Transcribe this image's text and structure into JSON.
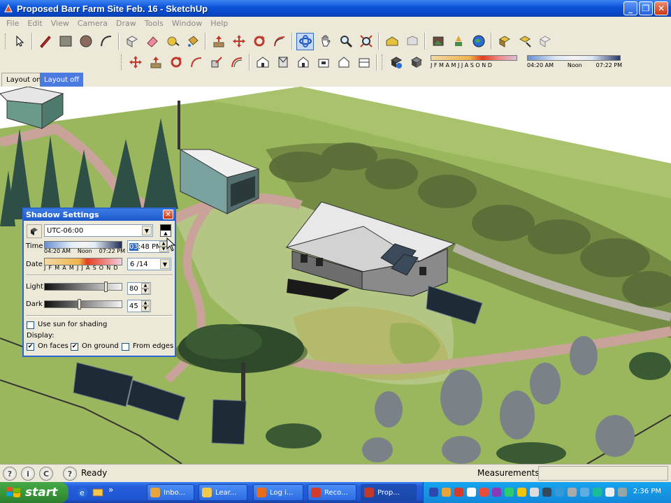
{
  "window": {
    "title": "Proposed Barr Farm Site Feb. 16 - SketchUp",
    "controls": {
      "minimize": "_",
      "maximize": "❐",
      "close": "✕"
    }
  },
  "menu": [
    "File",
    "Edit",
    "View",
    "Camera",
    "Draw",
    "Tools",
    "Window",
    "Help"
  ],
  "toolbar": {
    "shadow_months": "J F M A M J J A S O N D",
    "shadow_time_start": "04:20 AM",
    "shadow_time_mid": "Noon",
    "shadow_time_end": "07:22 PM"
  },
  "layout_tabs": {
    "on": "Layout on",
    "off": "Layout off"
  },
  "shadow_settings": {
    "title": "Shadow Settings",
    "timezone": "UTC-06:00",
    "time_label": "Time",
    "time_start": "04:20 AM",
    "time_mid": "Noon",
    "time_end": "07:22 PM",
    "time_value_selected": "03",
    "time_value_rest": ":48 PM",
    "date_label": "Date",
    "date_months": "J F M A M J J A S O N D",
    "date_value": "6 /14",
    "light_label": "Light",
    "light_value": "80",
    "light_level": 80,
    "dark_label": "Dark",
    "dark_value": "45",
    "dark_level": 45,
    "use_sun_label": "Use sun for shading",
    "use_sun_checked": false,
    "display_label": "Display:",
    "on_faces_label": "On faces",
    "on_faces_checked": true,
    "on_ground_label": "On ground",
    "on_ground_checked": true,
    "from_edges_label": "From edges",
    "from_edges_checked": false
  },
  "status": {
    "ready": "Ready",
    "measurements_label": "Measurements",
    "measurements_value": ""
  },
  "taskbar": {
    "start": "start",
    "tasks": [
      {
        "label": "Inbo...",
        "color": "#e8a33a"
      },
      {
        "label": "Lear...",
        "color": "#f3c84b"
      },
      {
        "label": "Log i...",
        "color": "#e76d1e"
      },
      {
        "label": "Reco...",
        "color": "#d33b2c"
      },
      {
        "label": "Prop...",
        "color": "#c0392b"
      }
    ],
    "clock": "2:36 PM"
  },
  "colors": {
    "xp_blue": "#0a52d8",
    "grass": "#9bb75e",
    "grass_light": "#b8c98a",
    "path": "#c9a39a",
    "tree_dark": "#2e4f45",
    "tree_gray": "#7a8288",
    "roof": "#e8e8e8"
  }
}
